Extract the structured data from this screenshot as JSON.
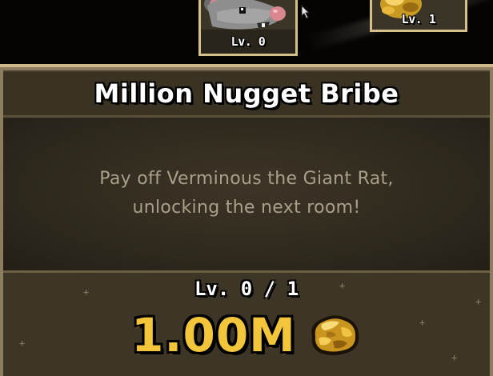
{
  "items": {
    "rat_card": {
      "level_label": "Lv. 0"
    },
    "nugget_card": {
      "level_label": "Lv. 1"
    }
  },
  "upgrade": {
    "title": "Million Nugget Bribe",
    "description_line1": "Pay off Verminous the Giant Rat,",
    "description_line2": "unlocking the next room!",
    "level_progress": "Lv. 0 / 1",
    "cost": "1.00M",
    "cost_icon": "gold-nugget-icon"
  },
  "colors": {
    "gold": "#f2c53a",
    "panel_border": "#cdb98a",
    "panel_bg": "#2c271c",
    "text_muted": "#a9a08c"
  }
}
